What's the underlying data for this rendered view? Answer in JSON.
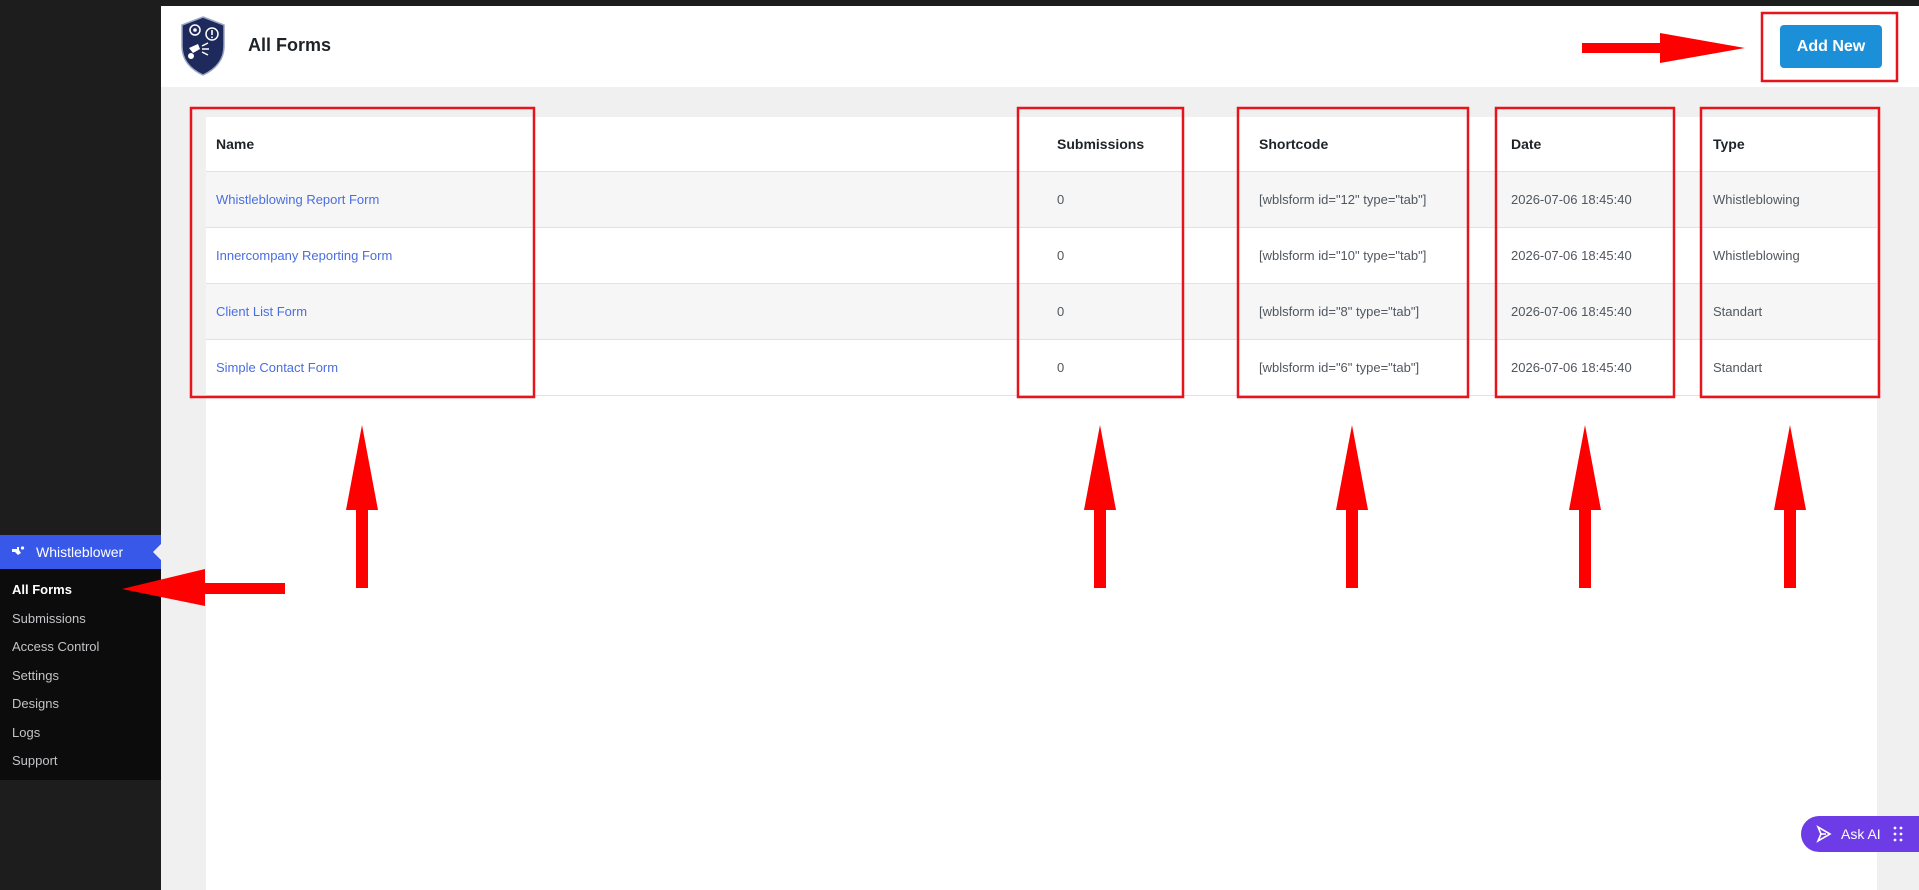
{
  "sidebar": {
    "parent_label": "Whistleblower",
    "items": [
      {
        "label": "All Forms",
        "current": true
      },
      {
        "label": "Submissions"
      },
      {
        "label": "Access Control"
      },
      {
        "label": "Settings"
      },
      {
        "label": "Designs"
      },
      {
        "label": "Logs"
      },
      {
        "label": "Support"
      }
    ]
  },
  "header": {
    "title": "All Forms",
    "add_new_label": "Add New",
    "logo_icon": "shield-logo-icon"
  },
  "table": {
    "columns": [
      "Name",
      "Submissions",
      "Shortcode",
      "Date",
      "Type"
    ],
    "rows": [
      {
        "name": "Whistleblowing Report Form",
        "submissions": "0",
        "shortcode": "[wblsform id=\"12\" type=\"tab\"]",
        "date": "2026-07-06 18:45:40",
        "type": "Whistleblowing"
      },
      {
        "name": "Innercompany Reporting Form",
        "submissions": "0",
        "shortcode": "[wblsform id=\"10\" type=\"tab\"]",
        "date": "2026-07-06 18:45:40",
        "type": "Whistleblowing"
      },
      {
        "name": "Client List Form",
        "submissions": "0",
        "shortcode": "[wblsform id=\"8\" type=\"tab\"]",
        "date": "2026-07-06 18:45:40",
        "type": "Standart"
      },
      {
        "name": "Simple Contact Form",
        "submissions": "0",
        "shortcode": "[wblsform id=\"6\" type=\"tab\"]",
        "date": "2026-07-06 18:45:40",
        "type": "Standart"
      }
    ]
  },
  "ask_ai": {
    "label": "Ask AI"
  },
  "colors": {
    "accent": "#1b8fd8",
    "sidebar_active": "#3858e9",
    "link": "#4a6ee0",
    "annotation": "#ff0000",
    "ask_ai": "#6d3ce6"
  }
}
